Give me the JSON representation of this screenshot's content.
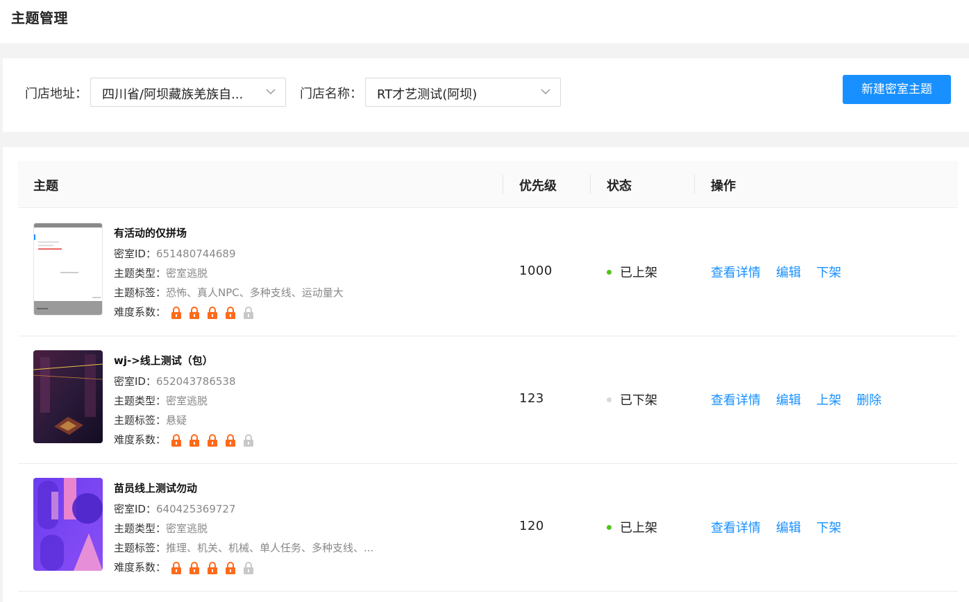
{
  "page": {
    "title": "主题管理"
  },
  "filters": {
    "address_label": "门店地址：",
    "address_value": "四川省/阿坝藏族羌族自...",
    "store_label": "门店名称：",
    "store_value": "RT才艺测试(阿坝)",
    "create_button": "新建密室主题"
  },
  "table": {
    "headers": {
      "theme": "主题",
      "priority": "优先级",
      "status": "状态",
      "actions": "操作"
    },
    "rows": [
      {
        "name": "有活动的仅拼场",
        "id_label": "密室ID：",
        "id": "651480744689",
        "type_label": "主题类型：",
        "type": "密室逃脱",
        "tags_label": "主题标签：",
        "tags": "恐怖、真人NPC、多种支线、运动量大",
        "difficulty_label": "难度系数：",
        "difficulty": 4,
        "difficulty_max": 5,
        "priority": "1000",
        "status": "已上架",
        "status_color": "#52c41a",
        "actions": [
          "查看详情",
          "编辑",
          "下架"
        ]
      },
      {
        "name": "wj->线上测试（包）",
        "id_label": "密室ID：",
        "id": "652043786538",
        "type_label": "主题类型：",
        "type": "密室逃脱",
        "tags_label": "主题标签：",
        "tags": "悬疑",
        "difficulty_label": "难度系数：",
        "difficulty": 4,
        "difficulty_max": 5,
        "priority": "123",
        "status": "已下架",
        "status_color": "#d9d9d9",
        "actions": [
          "查看详情",
          "编辑",
          "上架",
          "删除"
        ]
      },
      {
        "name": "苗员线上测试勿动",
        "id_label": "密室ID：",
        "id": "640425369727",
        "type_label": "主题类型：",
        "type": "密室逃脱",
        "tags_label": "主题标签：",
        "tags": "推理、机关、机械、单人任务、多种支线、...",
        "difficulty_label": "难度系数：",
        "difficulty": 4,
        "difficulty_max": 5,
        "priority": "120",
        "status": "已上架",
        "status_color": "#52c41a",
        "actions": [
          "查看详情",
          "编辑",
          "下架"
        ]
      }
    ]
  },
  "colors": {
    "primary": "#1890ff",
    "lock_active": "#ff6a1a",
    "lock_inactive": "#c8c8c8"
  }
}
